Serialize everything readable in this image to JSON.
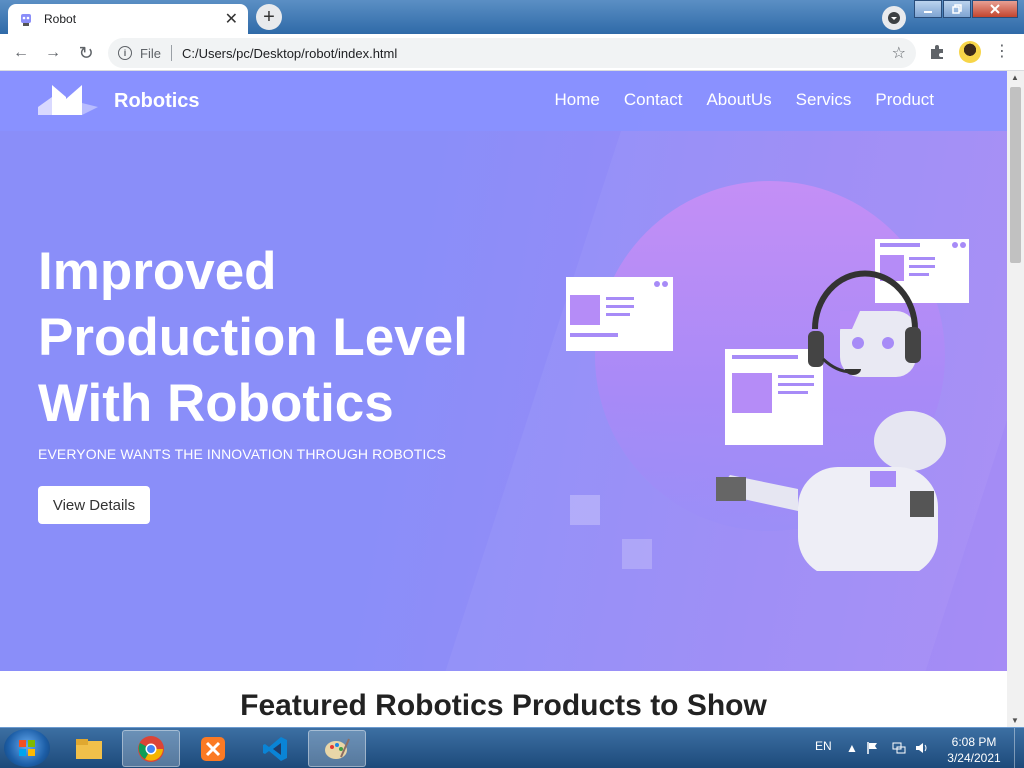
{
  "browser": {
    "tab_title": "Robot",
    "close_glyph": "✕",
    "new_tab_glyph": "+",
    "url_scheme": "File",
    "url_path": "C:/Users/pc/Desktop/robot/index.html",
    "back_glyph": "←",
    "forward_glyph": "→",
    "reload_glyph": "↻",
    "star_glyph": "☆",
    "menu_glyph": "⋮",
    "info_glyph": "i"
  },
  "site": {
    "brand": "Robotics",
    "nav": [
      "Home",
      "Contact",
      "AboutUs",
      "Servics",
      "Product"
    ],
    "headline_lines": [
      "Improved",
      "Production Level",
      "With Robotics"
    ],
    "tagline": "EVERYONE WANTS THE INNOVATION THROUGH ROBOTICS",
    "cta": "View Details",
    "section_title": "Featured Robotics Products to Show",
    "colors": {
      "hero": "#8a8ef9",
      "accent_pink": "#f0457a",
      "white": "#ffffff"
    }
  },
  "taskbar": {
    "language": "EN",
    "time": "6:08 PM",
    "date": "3/24/2021",
    "apps": [
      "file-explorer-icon",
      "chrome-icon",
      "xampp-icon",
      "vscode-icon",
      "paint-icon"
    ]
  }
}
